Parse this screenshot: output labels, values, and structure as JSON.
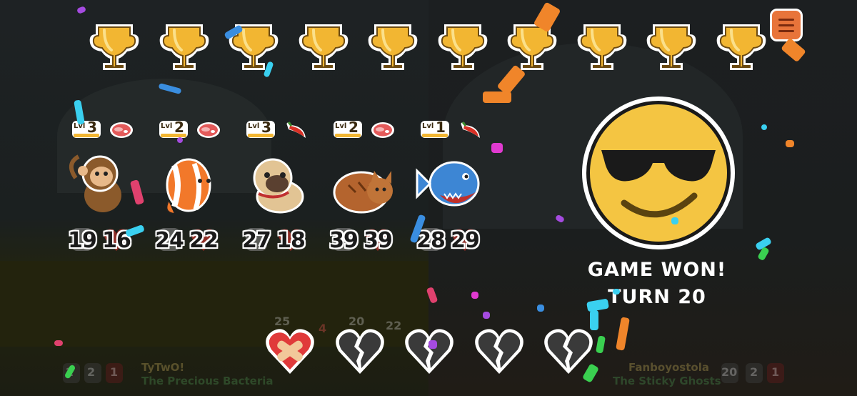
{
  "trophies": {
    "count": 10,
    "icon": "trophy-icon"
  },
  "menu": {
    "icon": "hamburger-menu-icon"
  },
  "pets": [
    {
      "name": "monkey",
      "level_label": "Lvl",
      "level": "3",
      "food": "steak",
      "attack": "19",
      "health": "16"
    },
    {
      "name": "clownfish",
      "level_label": "Lvl",
      "level": "2",
      "food": "steak",
      "attack": "24",
      "health": "22"
    },
    {
      "name": "pug",
      "level_label": "Lvl",
      "level": "3",
      "food": "chili",
      "attack": "27",
      "health": "18"
    },
    {
      "name": "cat",
      "level_label": "Lvl",
      "level": "2",
      "food": "steak",
      "attack": "39",
      "health": "39"
    },
    {
      "name": "piranha",
      "level_label": "Lvl",
      "level": "1",
      "food": "chili",
      "attack": "28",
      "health": "29"
    }
  ],
  "result": {
    "title": "GAME WON!",
    "turn": "TURN 20",
    "face": "sunglasses-face"
  },
  "lives": [
    {
      "state": "bandaged"
    },
    {
      "state": "broken"
    },
    {
      "state": "broken"
    },
    {
      "state": "broken"
    },
    {
      "state": "broken"
    }
  ],
  "footer": {
    "left": {
      "player": "TyTwO!",
      "team": "The Precious Bacteria",
      "values": [
        "2",
        "2",
        "1"
      ]
    },
    "right": {
      "player": "Fanboyostola",
      "team": "The Sticky Ghosts",
      "values": [
        "20",
        "2",
        "1"
      ]
    },
    "background_stats": [
      "25",
      "4",
      "20",
      "22"
    ]
  },
  "colors": {
    "accent": "#e8743a",
    "gold": "#f2b632",
    "text": "#ffffff"
  }
}
